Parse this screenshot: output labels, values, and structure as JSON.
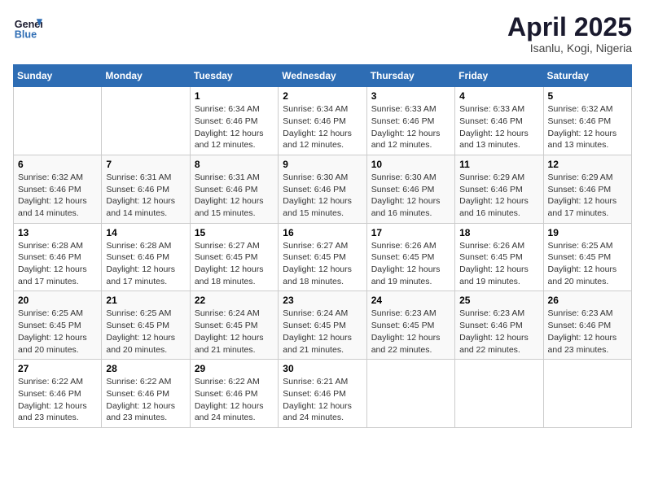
{
  "header": {
    "logo_line1": "General",
    "logo_line2": "Blue",
    "month_title": "April 2025",
    "location": "Isanlu, Kogi, Nigeria"
  },
  "days_of_week": [
    "Sunday",
    "Monday",
    "Tuesday",
    "Wednesday",
    "Thursday",
    "Friday",
    "Saturday"
  ],
  "weeks": [
    [
      {
        "day": "",
        "info": ""
      },
      {
        "day": "",
        "info": ""
      },
      {
        "day": "1",
        "info": "Sunrise: 6:34 AM\nSunset: 6:46 PM\nDaylight: 12 hours and 12 minutes."
      },
      {
        "day": "2",
        "info": "Sunrise: 6:34 AM\nSunset: 6:46 PM\nDaylight: 12 hours and 12 minutes."
      },
      {
        "day": "3",
        "info": "Sunrise: 6:33 AM\nSunset: 6:46 PM\nDaylight: 12 hours and 12 minutes."
      },
      {
        "day": "4",
        "info": "Sunrise: 6:33 AM\nSunset: 6:46 PM\nDaylight: 12 hours and 13 minutes."
      },
      {
        "day": "5",
        "info": "Sunrise: 6:32 AM\nSunset: 6:46 PM\nDaylight: 12 hours and 13 minutes."
      }
    ],
    [
      {
        "day": "6",
        "info": "Sunrise: 6:32 AM\nSunset: 6:46 PM\nDaylight: 12 hours and 14 minutes."
      },
      {
        "day": "7",
        "info": "Sunrise: 6:31 AM\nSunset: 6:46 PM\nDaylight: 12 hours and 14 minutes."
      },
      {
        "day": "8",
        "info": "Sunrise: 6:31 AM\nSunset: 6:46 PM\nDaylight: 12 hours and 15 minutes."
      },
      {
        "day": "9",
        "info": "Sunrise: 6:30 AM\nSunset: 6:46 PM\nDaylight: 12 hours and 15 minutes."
      },
      {
        "day": "10",
        "info": "Sunrise: 6:30 AM\nSunset: 6:46 PM\nDaylight: 12 hours and 16 minutes."
      },
      {
        "day": "11",
        "info": "Sunrise: 6:29 AM\nSunset: 6:46 PM\nDaylight: 12 hours and 16 minutes."
      },
      {
        "day": "12",
        "info": "Sunrise: 6:29 AM\nSunset: 6:46 PM\nDaylight: 12 hours and 17 minutes."
      }
    ],
    [
      {
        "day": "13",
        "info": "Sunrise: 6:28 AM\nSunset: 6:46 PM\nDaylight: 12 hours and 17 minutes."
      },
      {
        "day": "14",
        "info": "Sunrise: 6:28 AM\nSunset: 6:46 PM\nDaylight: 12 hours and 17 minutes."
      },
      {
        "day": "15",
        "info": "Sunrise: 6:27 AM\nSunset: 6:45 PM\nDaylight: 12 hours and 18 minutes."
      },
      {
        "day": "16",
        "info": "Sunrise: 6:27 AM\nSunset: 6:45 PM\nDaylight: 12 hours and 18 minutes."
      },
      {
        "day": "17",
        "info": "Sunrise: 6:26 AM\nSunset: 6:45 PM\nDaylight: 12 hours and 19 minutes."
      },
      {
        "day": "18",
        "info": "Sunrise: 6:26 AM\nSunset: 6:45 PM\nDaylight: 12 hours and 19 minutes."
      },
      {
        "day": "19",
        "info": "Sunrise: 6:25 AM\nSunset: 6:45 PM\nDaylight: 12 hours and 20 minutes."
      }
    ],
    [
      {
        "day": "20",
        "info": "Sunrise: 6:25 AM\nSunset: 6:45 PM\nDaylight: 12 hours and 20 minutes."
      },
      {
        "day": "21",
        "info": "Sunrise: 6:25 AM\nSunset: 6:45 PM\nDaylight: 12 hours and 20 minutes."
      },
      {
        "day": "22",
        "info": "Sunrise: 6:24 AM\nSunset: 6:45 PM\nDaylight: 12 hours and 21 minutes."
      },
      {
        "day": "23",
        "info": "Sunrise: 6:24 AM\nSunset: 6:45 PM\nDaylight: 12 hours and 21 minutes."
      },
      {
        "day": "24",
        "info": "Sunrise: 6:23 AM\nSunset: 6:45 PM\nDaylight: 12 hours and 22 minutes."
      },
      {
        "day": "25",
        "info": "Sunrise: 6:23 AM\nSunset: 6:46 PM\nDaylight: 12 hours and 22 minutes."
      },
      {
        "day": "26",
        "info": "Sunrise: 6:23 AM\nSunset: 6:46 PM\nDaylight: 12 hours and 23 minutes."
      }
    ],
    [
      {
        "day": "27",
        "info": "Sunrise: 6:22 AM\nSunset: 6:46 PM\nDaylight: 12 hours and 23 minutes."
      },
      {
        "day": "28",
        "info": "Sunrise: 6:22 AM\nSunset: 6:46 PM\nDaylight: 12 hours and 23 minutes."
      },
      {
        "day": "29",
        "info": "Sunrise: 6:22 AM\nSunset: 6:46 PM\nDaylight: 12 hours and 24 minutes."
      },
      {
        "day": "30",
        "info": "Sunrise: 6:21 AM\nSunset: 6:46 PM\nDaylight: 12 hours and 24 minutes."
      },
      {
        "day": "",
        "info": ""
      },
      {
        "day": "",
        "info": ""
      },
      {
        "day": "",
        "info": ""
      }
    ]
  ]
}
